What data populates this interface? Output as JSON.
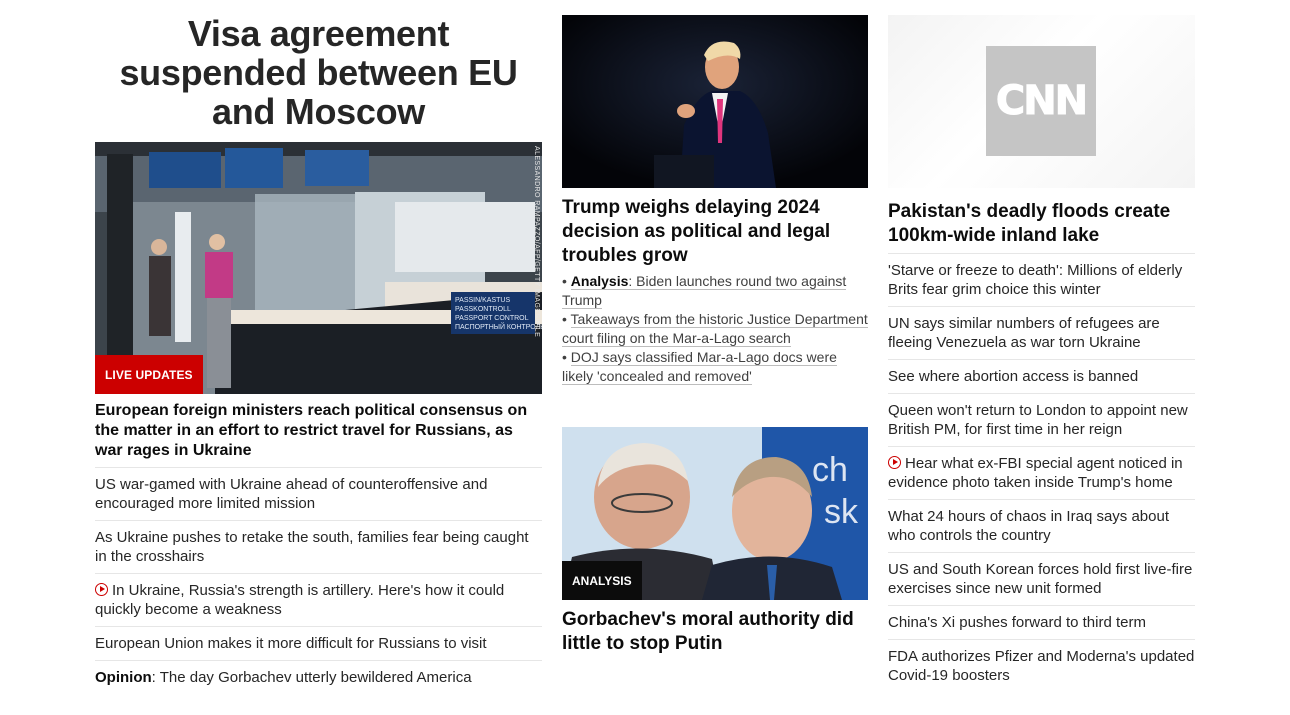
{
  "banner": {
    "title": "Visa agreement suspended between EU and Moscow"
  },
  "col1": {
    "image": {
      "badge": "LIVE UPDATES",
      "credit": "ALESSANDRO RAMPAZZO/AFP/GETTY IMAGES/FILE",
      "sign_text": [
        "PASSIN/KASTUS",
        "PASSKONTROLL",
        "PASSPORT CONTROL",
        "ПАСПОРТНЫЙ КОНТРОЛЬ"
      ]
    },
    "headline": "European foreign ministers reach political consensus on the matter in an effort to restrict travel for Russians, as war rages in Ukraine",
    "items": [
      {
        "text": "US war-gamed with Ukraine ahead of counteroffensive and encouraged more limited mission"
      },
      {
        "text": "As Ukraine pushes to retake the south, families fear being caught in the crosshairs"
      },
      {
        "text": "In Ukraine, Russia's strength is artillery. Here's how it could quickly become a weakness",
        "video": true
      },
      {
        "text": "European Union makes it more difficult for Russians to visit"
      },
      {
        "lead": "Opinion",
        "text": ": The day Gorbachev utterly bewildered America"
      }
    ]
  },
  "col2": {
    "headline": "Trump weighs delaying 2024 decision as political and legal troubles grow",
    "bullets": [
      {
        "prefix": "• ",
        "lead": "Analysis",
        "text": ": Biden launches round two against Trump"
      },
      {
        "prefix": "• ",
        "lead": "",
        "text": "Takeaways from the historic Justice Department court filing on the Mar-a-Lago search"
      },
      {
        "prefix": "• ",
        "lead": "",
        "text": "DOJ says classified Mar-a-Lago docs were likely 'concealed and removed'"
      }
    ],
    "story2": {
      "badge": "ANALYSIS",
      "headline": "Gorbachev's moral authority did little to stop Putin"
    }
  },
  "col3": {
    "logo_text": "CNN",
    "headline": "Pakistan's deadly floods create 100km-wide inland lake",
    "items": [
      {
        "text": "'Starve or freeze to death': Millions of elderly Brits fear grim choice this winter"
      },
      {
        "text": "UN says similar numbers of refugees are fleeing Venezuela as war torn Ukraine"
      },
      {
        "text": "See where abortion access is banned"
      },
      {
        "text": "Queen won't return to London to appoint new British PM, for first time in her reign"
      },
      {
        "text": "Hear what ex-FBI special agent noticed in evidence photo taken inside Trump's home",
        "video": true
      },
      {
        "text": "What 24 hours of chaos in Iraq says about who controls the country"
      },
      {
        "text": "US and South Korean forces hold first live-fire exercises since new unit formed"
      },
      {
        "text": "China's Xi pushes forward to third term"
      },
      {
        "text": "FDA authorizes Pfizer and Moderna's updated Covid-19 boosters"
      }
    ]
  },
  "colors": {
    "accent_red": "#cc0000",
    "text_dark": "#0c0c0c",
    "text_body": "#262626",
    "divider": "#e6e6e6"
  }
}
